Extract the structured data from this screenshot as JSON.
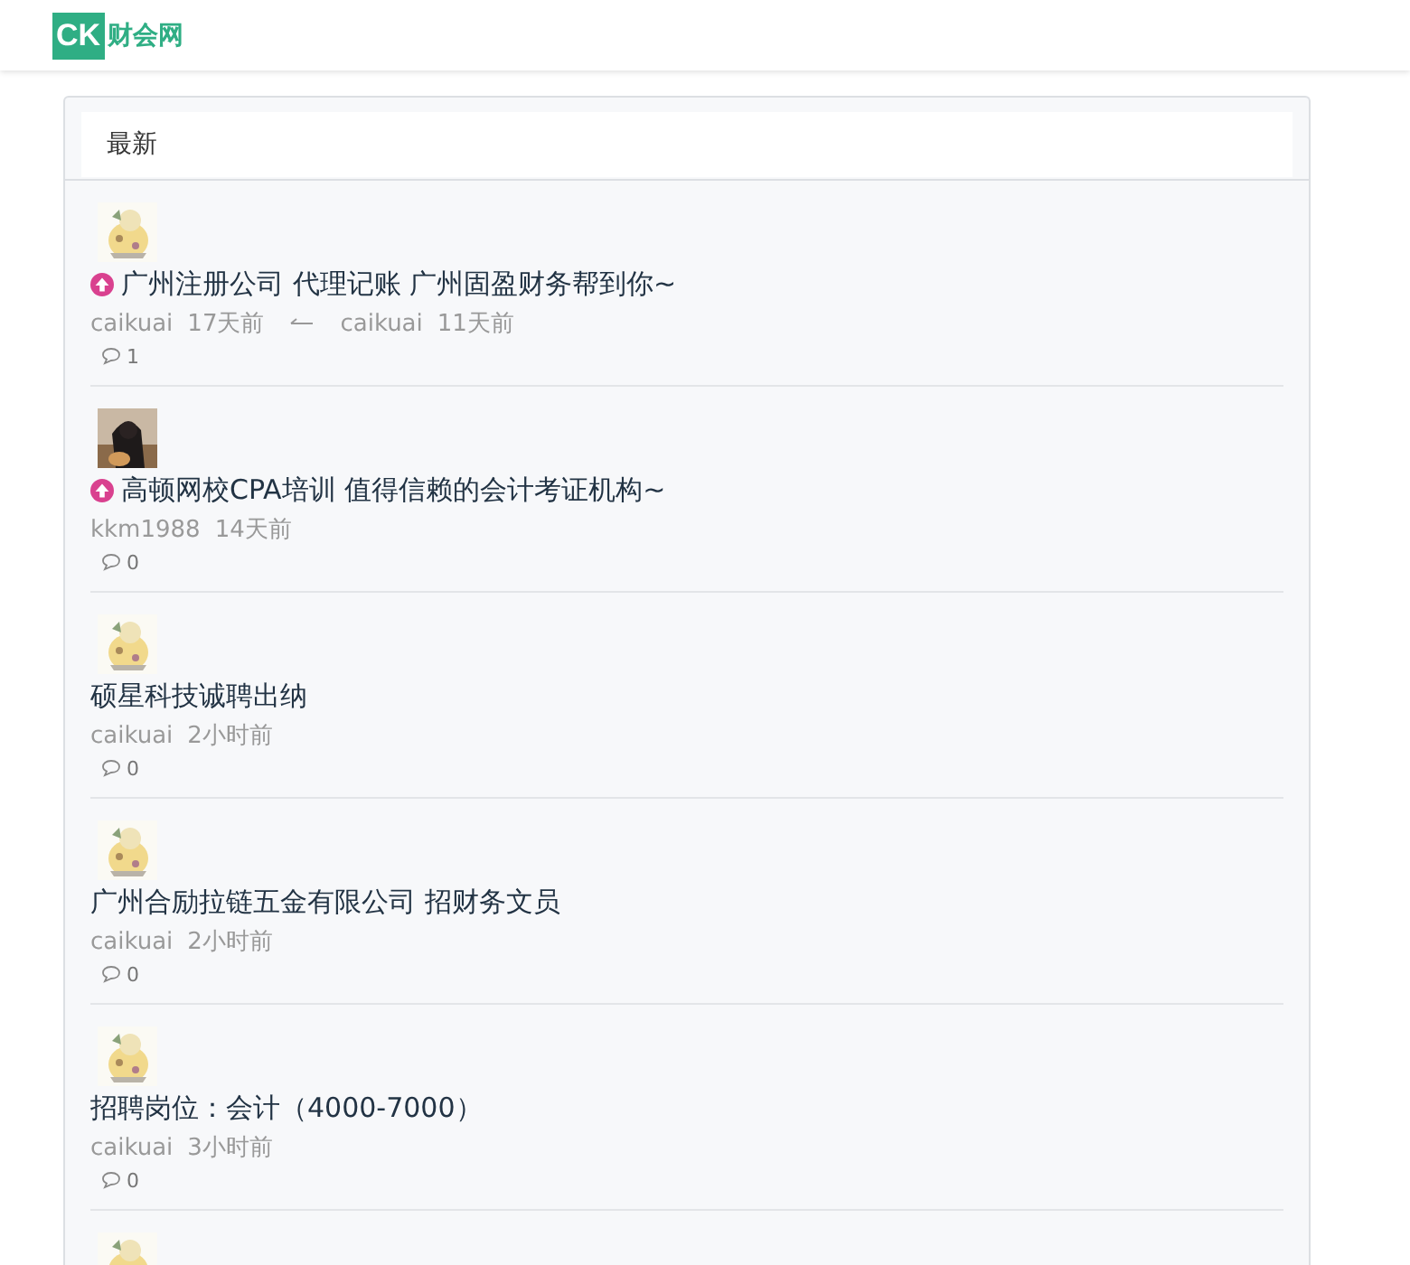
{
  "site": {
    "logo_mark": "CK",
    "logo_name": "财会网"
  },
  "panel": {
    "heading": "最新"
  },
  "posts": [
    {
      "pinned": true,
      "title": "广州注册公司 代理记账 广州固盈财务帮到你~",
      "author": "caikuai",
      "time": "17天前",
      "last_reply": {
        "user": "caikuai",
        "time": "11天前"
      },
      "comments": "1"
    },
    {
      "pinned": true,
      "title": "高顿网校CPA培训 值得信赖的会计考证机构~",
      "author": "kkm1988",
      "time": "14天前",
      "comments": "0"
    },
    {
      "pinned": false,
      "title": "硕星科技诚聘出纳",
      "author": "caikuai",
      "time": "2小时前",
      "comments": "0"
    },
    {
      "pinned": false,
      "title": "广州合励拉链五金有限公司 招财务文员",
      "author": "caikuai",
      "time": "2小时前",
      "comments": "0"
    },
    {
      "pinned": false,
      "title": "招聘岗位：会计（4000-7000）",
      "author": "caikuai",
      "time": "3小时前",
      "comments": "0"
    }
  ]
}
